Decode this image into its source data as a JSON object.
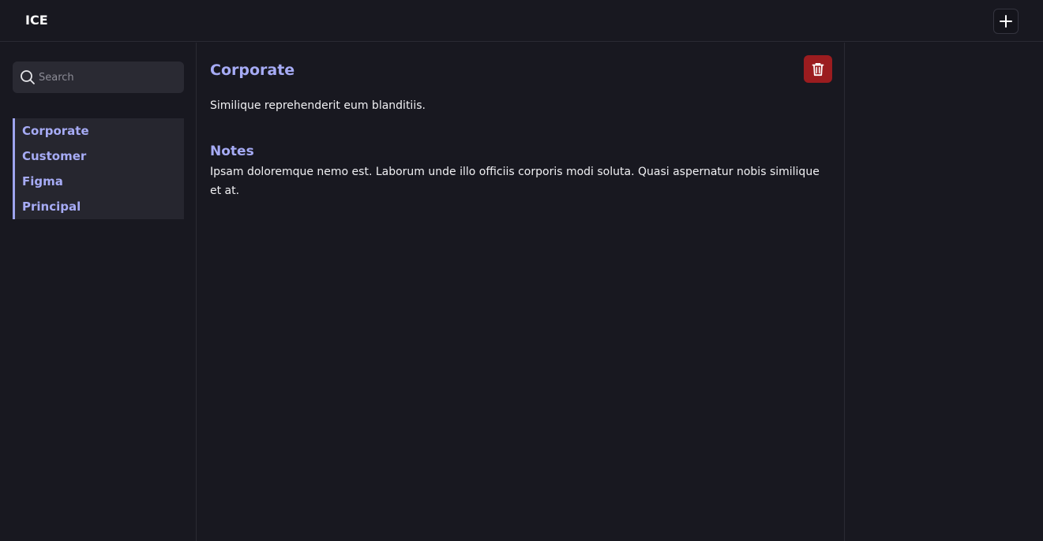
{
  "app": {
    "title": "ICE",
    "add_icon": "plus-icon"
  },
  "sidebar": {
    "search": {
      "placeholder": "Search",
      "value": "",
      "icon": "search-icon"
    },
    "items": [
      {
        "label": "Corporate"
      },
      {
        "label": "Customer"
      },
      {
        "label": "Figma"
      },
      {
        "label": "Principal"
      }
    ]
  },
  "detail": {
    "title": "Corporate",
    "description": "Similique reprehenderit eum blanditiis.",
    "notes_heading": "Notes",
    "notes": "Ipsam doloremque nemo est. Laborum unde illo officiis corporis modi soluta. Quasi aspernatur nobis similique et at.",
    "delete_icon": "trash-icon"
  },
  "colors": {
    "background": "#181820",
    "accent": "#a6abf5",
    "danger": "#9b1c1f",
    "panel": "#26262f"
  }
}
